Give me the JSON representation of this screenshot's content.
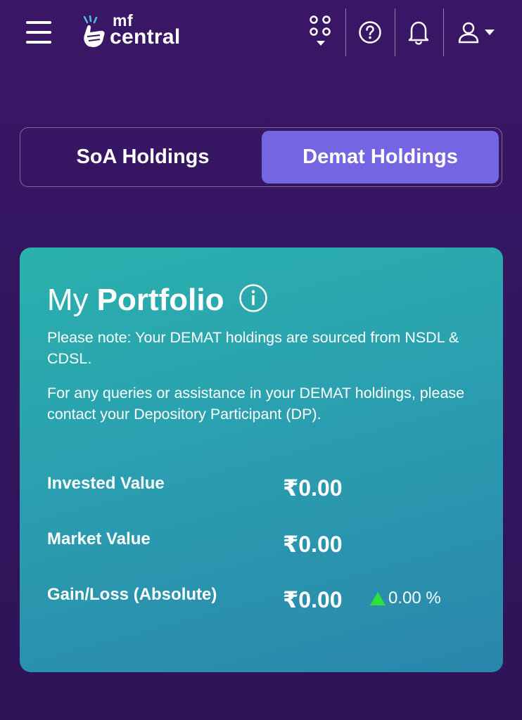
{
  "header": {
    "logo_top": "mf",
    "logo_bottom": "central",
    "icons": [
      "menu-icon",
      "apps-grid-icon",
      "help-icon",
      "bell-icon",
      "user-icon"
    ]
  },
  "tabs": [
    {
      "label": "SoA Holdings",
      "active": false
    },
    {
      "label": "Demat Holdings",
      "active": true
    }
  ],
  "portfolio": {
    "title_light": "My",
    "title_bold": "Portfolio",
    "note1": "Please note: Your DEMAT holdings are sourced from NSDL & CDSL.",
    "note2": "For any queries or assistance in your DEMAT holdings, please contact your Depository Participant (DP).",
    "rows": [
      {
        "label": "Invested Value",
        "value": "₹0.00"
      },
      {
        "label": "Market Value",
        "value": "₹0.00"
      },
      {
        "label": "Gain/Loss (Absolute)",
        "value": "₹0.00"
      }
    ],
    "gain_pct": "0.00 %"
  },
  "colors": {
    "background": "#331660",
    "active_tab": "#7665e2",
    "card_start": "#2ab1ad",
    "card_end": "#2a86ab",
    "gain_up": "#2fe23a"
  }
}
